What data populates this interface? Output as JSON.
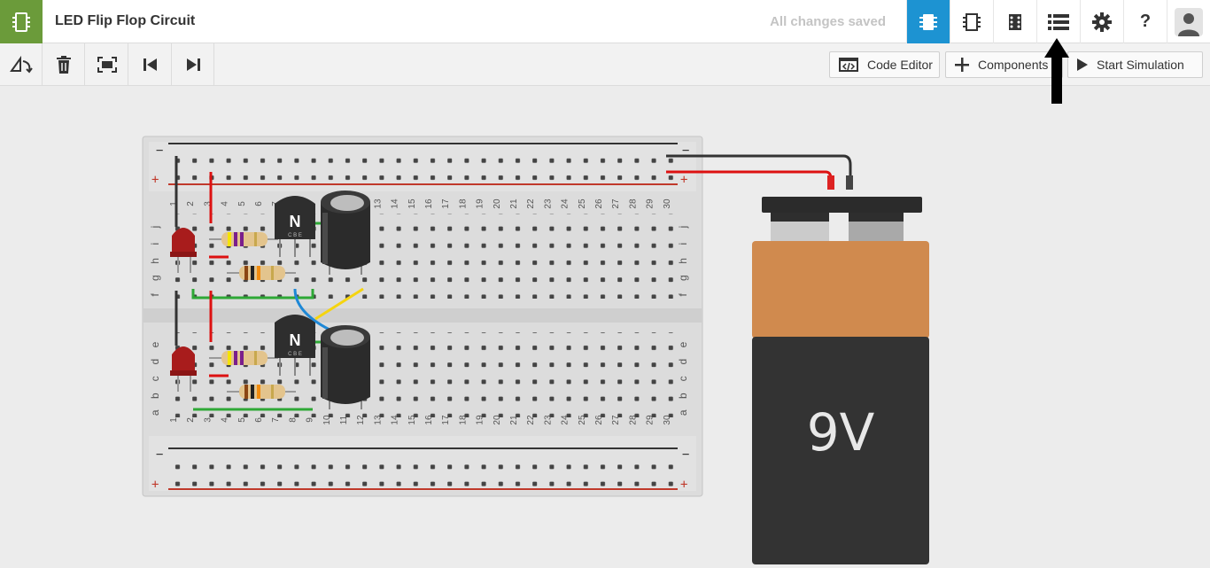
{
  "app": {
    "project_title": "LED Flip Flop Circuit",
    "save_status": "All changes saved"
  },
  "top_icons": [
    "circuit-view-icon",
    "schematic-view-icon",
    "pcb-view-icon",
    "component-list-icon",
    "settings-icon",
    "help-icon",
    "user-avatar-icon"
  ],
  "toolbar": {
    "tools": [
      "rotate-icon",
      "delete-icon",
      "zoom-to-fit-icon",
      "step-back-icon",
      "step-forward-icon"
    ],
    "code_editor_label": "Code Editor",
    "components_label": "Components",
    "start_simulation_label": "Start Simulation"
  },
  "breadboard": {
    "rail_minus": "−",
    "rail_plus": "+",
    "row_letters_top": [
      "j",
      "i",
      "h",
      "g",
      "f"
    ],
    "row_letters_bottom": [
      "e",
      "d",
      "c",
      "b",
      "a"
    ],
    "column_numbers": [
      "1",
      "2",
      "3",
      "4",
      "5",
      "6",
      "7",
      "8",
      "9",
      "10",
      "11",
      "12",
      "13",
      "14",
      "15",
      "16",
      "17",
      "18",
      "19",
      "20",
      "21",
      "22",
      "23",
      "24",
      "25",
      "26",
      "27",
      "28",
      "29",
      "30"
    ],
    "transistor_label": "N",
    "transistor_pins": "C B E"
  },
  "battery": {
    "label": "9V"
  },
  "colors": {
    "accent": "#1d93d2",
    "brand": "#6b9b3a",
    "battery_top": "#d08a4e",
    "battery_body": "#333333"
  }
}
